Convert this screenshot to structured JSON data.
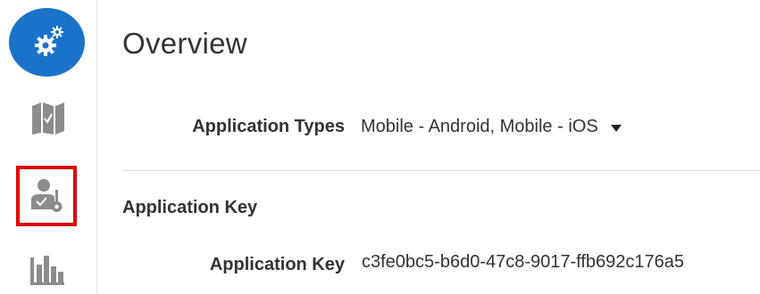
{
  "sidebar": {
    "items": [
      {
        "icon": "settings-gears-icon",
        "active": true
      },
      {
        "icon": "map-panels-icon",
        "active": false
      },
      {
        "icon": "user-key-icon",
        "active": false,
        "highlighted": true
      },
      {
        "icon": "bar-chart-icon",
        "active": false
      }
    ],
    "colors": {
      "active_bg": "#1b73c9",
      "icon_gray": "#8c8c8c",
      "highlight": "#e00000"
    }
  },
  "main": {
    "title": "Overview",
    "application_types": {
      "label": "Application Types",
      "value": "Mobile - Android, Mobile - iOS"
    },
    "section_heading": "Application Key",
    "application_key": {
      "label": "Application Key",
      "value": "c3fe0bc5-b6d0-47c8-9017-ffb692c176a5"
    }
  }
}
